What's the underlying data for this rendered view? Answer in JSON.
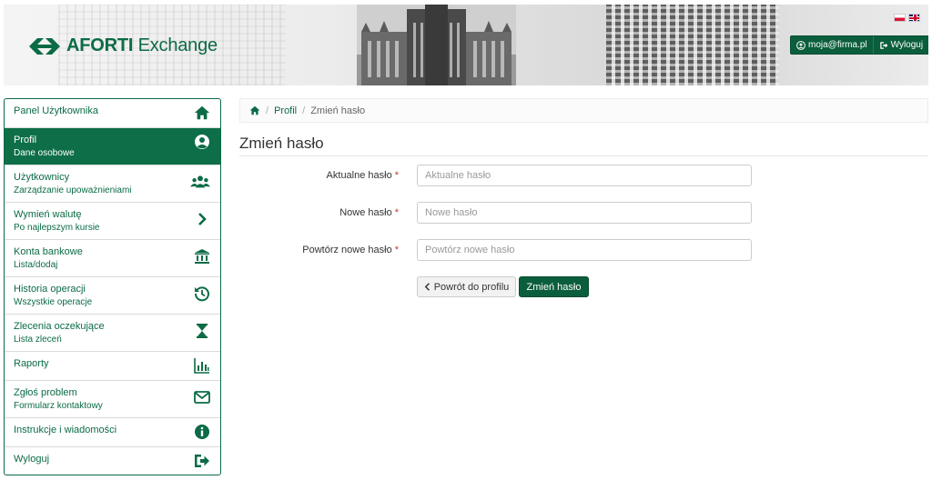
{
  "header": {
    "logo_bold": "AFORTI",
    "logo_light": " Exchange",
    "user_email": "moja@firma.pl",
    "logout_label": "Wyloguj",
    "languages": [
      "pl",
      "en"
    ]
  },
  "sidebar": {
    "items": [
      {
        "title": "Panel Użytkownika",
        "subtitle": "",
        "icon": "home-icon"
      },
      {
        "title": "Profil",
        "subtitle": "Dane osobowe",
        "icon": "user-circle-icon",
        "active": true
      },
      {
        "title": "Użytkownicy",
        "subtitle": "Zarządzanie upoważnieniami",
        "icon": "users-icon"
      },
      {
        "title": "Wymień walutę",
        "subtitle": "Po najlepszym kursie",
        "icon": "chevron-right-icon"
      },
      {
        "title": "Konta bankowe",
        "subtitle": "Lista/dodaj",
        "icon": "bank-icon"
      },
      {
        "title": "Historia operacji",
        "subtitle": "Wszystkie operacje",
        "icon": "history-icon"
      },
      {
        "title": "Zlecenia oczekujące",
        "subtitle": "Lista zleceń",
        "icon": "hourglass-icon"
      },
      {
        "title": "Raporty",
        "subtitle": "",
        "icon": "bar-chart-icon"
      },
      {
        "title": "Zgłoś problem",
        "subtitle": "Formularz kontaktowy",
        "icon": "envelope-icon"
      },
      {
        "title": "Instrukcje i wiadomości",
        "subtitle": "",
        "icon": "info-icon"
      },
      {
        "title": "Wyloguj",
        "subtitle": "",
        "icon": "sign-out-icon"
      }
    ]
  },
  "breadcrumb": {
    "home_icon": "home-icon",
    "link": "Profil",
    "current": "Zmień hasło"
  },
  "page": {
    "title": "Zmień hasło"
  },
  "form": {
    "required_mark": "*",
    "fields": [
      {
        "label": "Aktualne hasło",
        "placeholder": "Aktualne hasło",
        "value": ""
      },
      {
        "label": "Nowe hasło",
        "placeholder": "Nowe hasło",
        "value": ""
      },
      {
        "label": "Powtórz nowe hasło",
        "placeholder": "Powtórz nowe hasło",
        "value": ""
      }
    ],
    "back_label": "Powrót do profilu",
    "submit_label": "Zmień hasło"
  },
  "colors": {
    "brand_green": "#0b6b45",
    "brand_dark": "#0b5e3c",
    "required": "#c0392b"
  }
}
